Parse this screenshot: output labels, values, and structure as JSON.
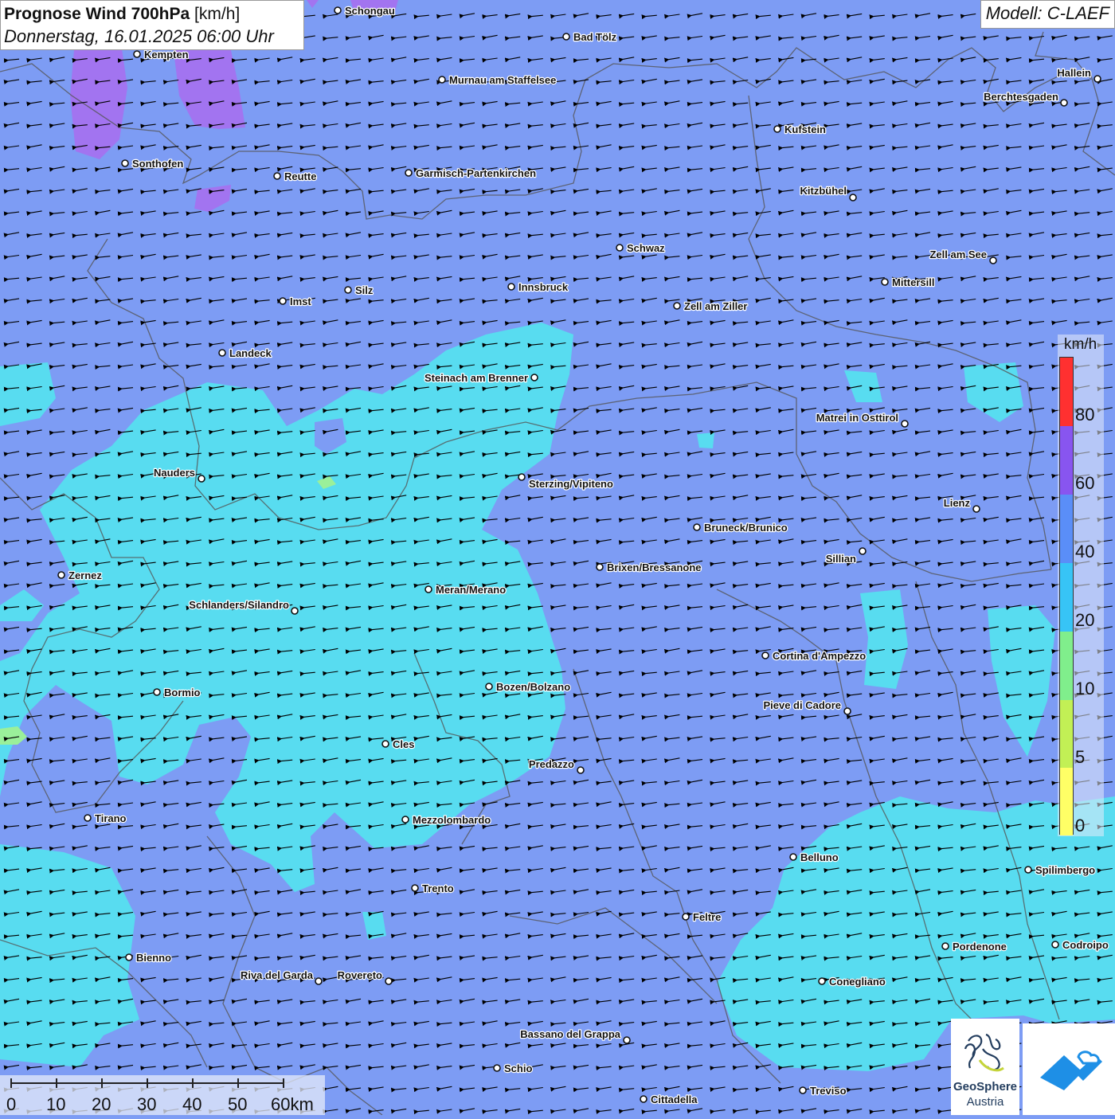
{
  "title": {
    "main": "Prognose Wind 700hPa",
    "unit": "[km/h]",
    "datetime": "Donnerstag, 16.01.2025 06:00 Uhr"
  },
  "model": "Modell: C-LAEF",
  "legend": {
    "unit": "km/h",
    "ticks": [
      "80",
      "60",
      "40",
      "20",
      "10",
      "5",
      "0"
    ],
    "colors": [
      "#ff3030",
      "#8855f0",
      "#5a8ef8",
      "#37c4f6",
      "#80ee8c",
      "#c2f055",
      "#ffff66"
    ]
  },
  "scalebar": {
    "labels": [
      "0",
      "10",
      "20",
      "30",
      "40",
      "50",
      "60km"
    ]
  },
  "logos": {
    "geosphere_line1": "GeoSphere",
    "geosphere_line2": "Austria"
  },
  "colors": {
    "background_40_60": "#7d9cf4",
    "band_20_40": "#58dcf0",
    "band_10_20": "#9af09a",
    "band_60_80": "#a274f0"
  },
  "wind": {
    "direction": "from east (arrows pointing west)"
  },
  "cities": [
    "Schongau",
    "Bad Tölz",
    "Kempten",
    "Murnau am Staffelsee",
    "Hallein",
    "Berchtesgaden",
    "Kufstein",
    "Sonthofen",
    "Reutte",
    "Garmisch-Partenkirchen",
    "Kitzbühel",
    "Schwaz",
    "Zell am See",
    "Innsbruck",
    "Mittersill",
    "Silz",
    "Imst",
    "Zell am Ziller",
    "Landeck",
    "Steinach am Brenner",
    "Matrei in Osttirol",
    "Nauders",
    "Sterzing/Vipiteno",
    "Lienz",
    "Bruneck/Brunico",
    "Sillian",
    "Zernez",
    "Brixen/Bressanone",
    "Meran/Merano",
    "Schlanders/Silandro",
    "Cortina d'Ampezzo",
    "Bozen/Bolzano",
    "Bormio",
    "Pieve di Cadore",
    "Cles",
    "Predazzo",
    "Tirano",
    "Mezzolombardo",
    "Belluno",
    "Spilimbergo",
    "Trento",
    "Feltre",
    "Pordenone",
    "Codroipo",
    "Bienno",
    "Riva del Garda",
    "Rovereto",
    "Conegliano",
    "Bassano del Grappa",
    "Schio",
    "Treviso",
    "Cittadella"
  ]
}
